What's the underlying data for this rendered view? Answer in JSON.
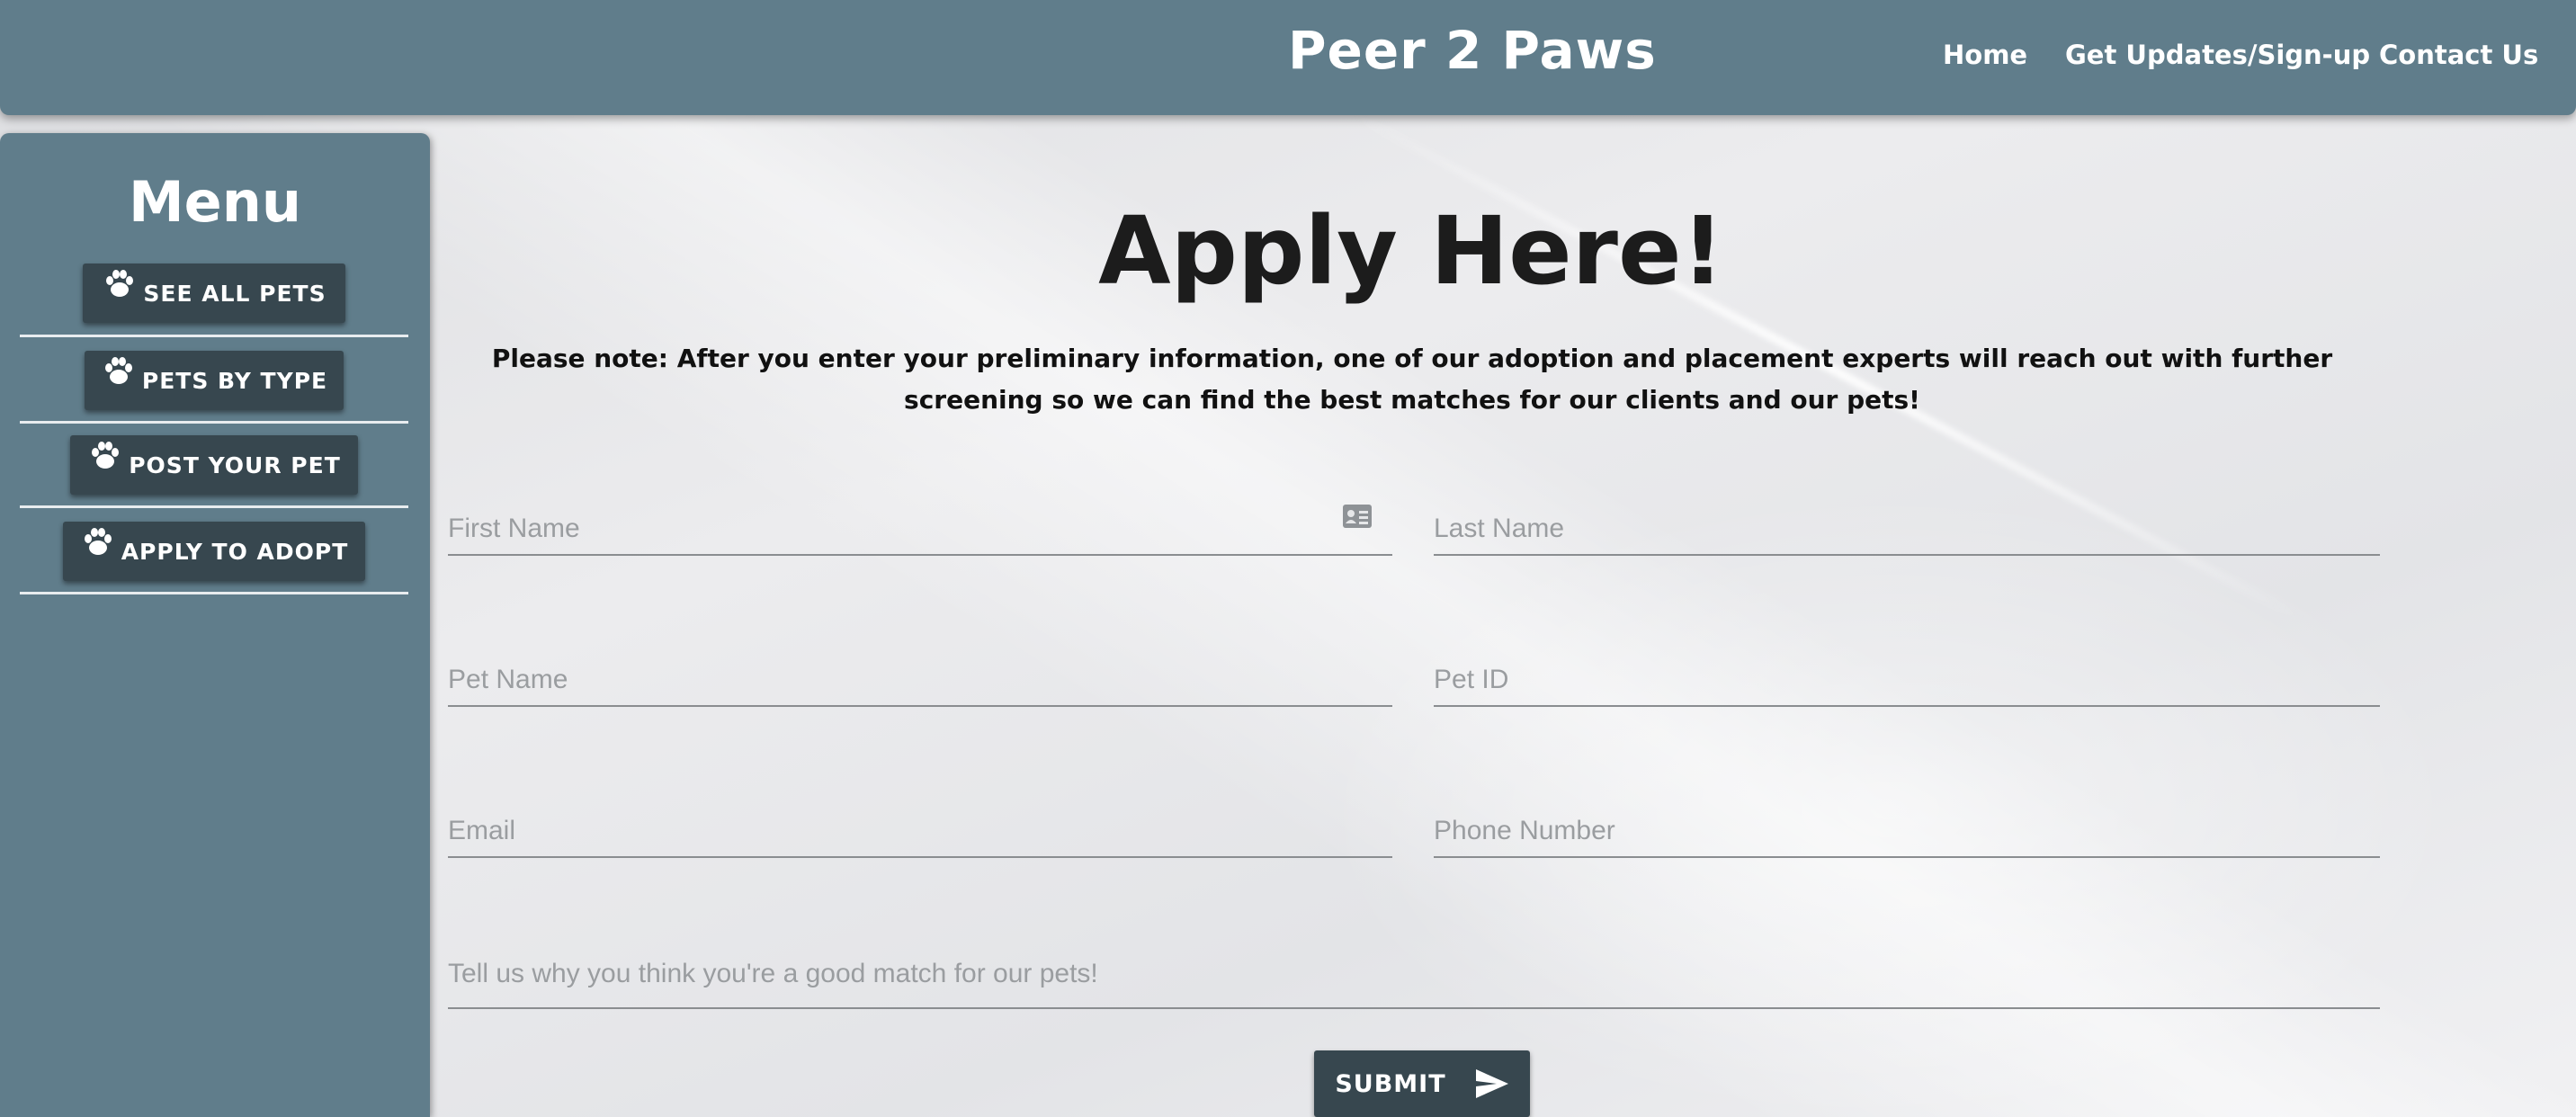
{
  "header": {
    "brand": "Peer 2 Paws",
    "nav": [
      "Home",
      "Get Updates/Sign-up",
      "Contact Us"
    ]
  },
  "sidebar": {
    "title": "Menu",
    "items": [
      {
        "label": "SEE ALL PETS",
        "icon": "paw-icon"
      },
      {
        "label": "PETS BY TYPE",
        "icon": "paw-icon"
      },
      {
        "label": "POST YOUR PET",
        "icon": "paw-icon"
      },
      {
        "label": "APPLY TO ADOPT",
        "icon": "paw-icon"
      }
    ]
  },
  "main": {
    "title": "Apply Here!",
    "note": "Please note: After you enter your preliminary information, one of our adoption and placement experts will reach out with further screening so we can find the best matches for our clients and our pets!"
  },
  "form": {
    "first_name": {
      "placeholder": "First Name",
      "value": ""
    },
    "last_name": {
      "placeholder": "Last Name",
      "value": ""
    },
    "pet_name": {
      "placeholder": "Pet Name",
      "value": ""
    },
    "pet_id": {
      "placeholder": "Pet ID",
      "value": ""
    },
    "email": {
      "placeholder": "Email",
      "value": ""
    },
    "phone": {
      "placeholder": "Phone Number",
      "value": ""
    },
    "message": {
      "placeholder": "Tell us why you think you're a good match for our pets!",
      "value": ""
    },
    "submit_label": "SUBMIT",
    "submit_icon": "send-icon",
    "first_name_icon": "contact-card-icon"
  },
  "colors": {
    "primary": "#607d8b",
    "dark": "#37474f",
    "text": "#1c1c1c"
  }
}
